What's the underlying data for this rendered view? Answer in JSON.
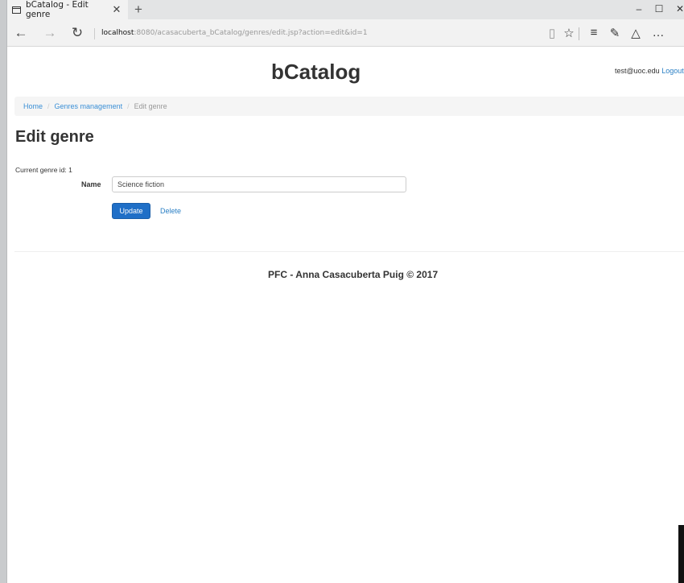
{
  "browser": {
    "tab_title": "bCatalog - Edit genre",
    "tab_close": "✕",
    "new_tab": "+",
    "url_host": "localhost",
    "url_rest": ":8080/acasacuberta_bCatalog/genres/edit.jsp?action=edit&id=1",
    "window_minimize": "–",
    "window_maximize": "☐",
    "window_close": "✕"
  },
  "page": {
    "brand": "bCatalog",
    "user_email": "test@uoc.edu",
    "logout": "Logout",
    "breadcrumb": {
      "home": "Home",
      "genres": "Genres management",
      "current": "Edit genre"
    },
    "heading": "Edit genre",
    "current_id": "Current genre id: 1",
    "form": {
      "name_label": "Name",
      "name_value": "Science fiction",
      "update_label": "Update",
      "delete_label": "Delete"
    },
    "footer": "PFC - Anna Casacuberta Puig © 2017"
  }
}
